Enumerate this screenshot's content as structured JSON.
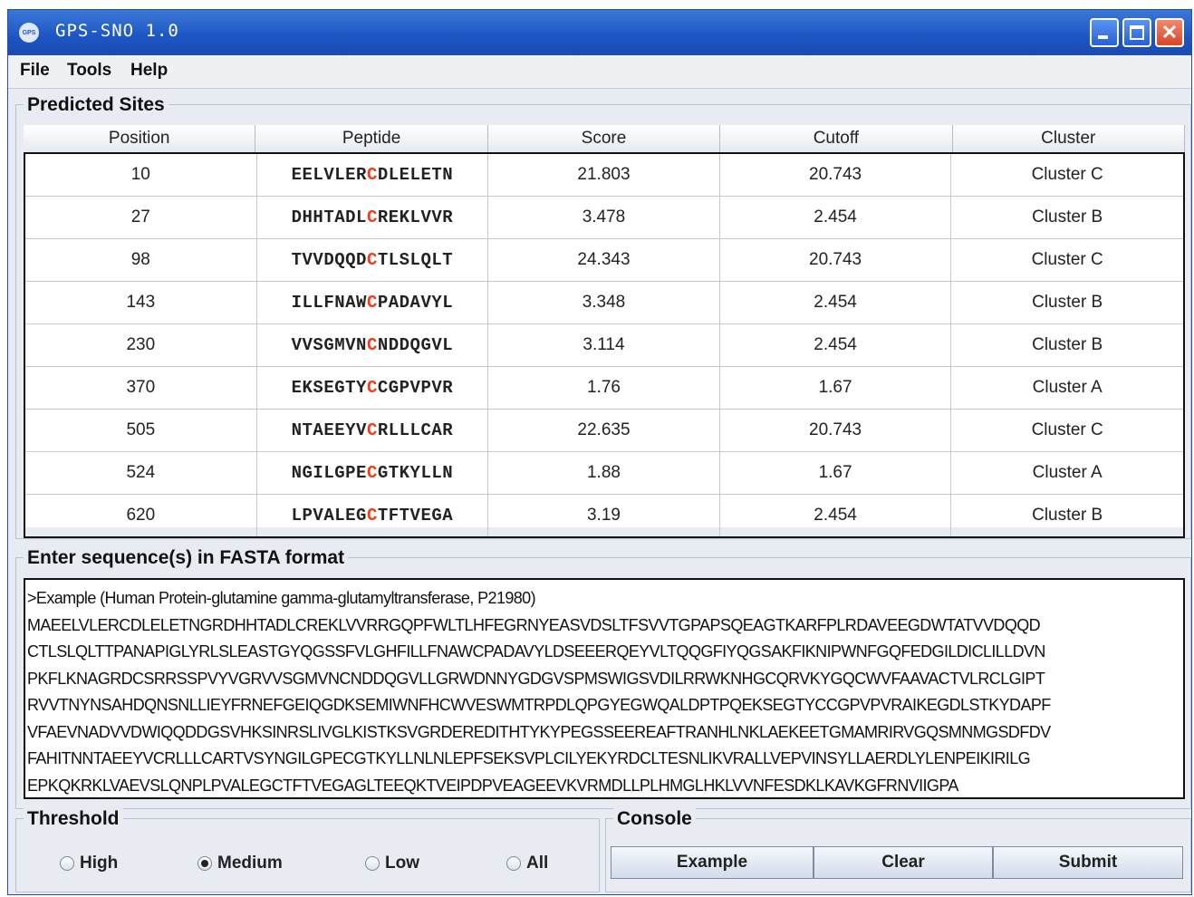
{
  "window": {
    "logo_text": "GPS",
    "title": "GPS-SNO 1.0",
    "minimize_label": "",
    "maximize_label": "",
    "close_label": "✕"
  },
  "menu": [
    "File",
    "Tools",
    "Help"
  ],
  "predicted_sites": {
    "title": "Predicted Sites",
    "columns": [
      "Position",
      "Peptide",
      "Score",
      "Cutoff",
      "Cluster"
    ],
    "rows": [
      {
        "position": "10",
        "pep_pre": "EELVLER",
        "pep_c": "C",
        "pep_post": "DLELETN",
        "score": "21.803",
        "cutoff": "20.743",
        "cluster": "Cluster C"
      },
      {
        "position": "27",
        "pep_pre": "DHHTADL",
        "pep_c": "C",
        "pep_post": "REKLVVR",
        "score": "3.478",
        "cutoff": "2.454",
        "cluster": "Cluster B"
      },
      {
        "position": "98",
        "pep_pre": "TVVDQQD",
        "pep_c": "C",
        "pep_post": "TLSLQLT",
        "score": "24.343",
        "cutoff": "20.743",
        "cluster": "Cluster C"
      },
      {
        "position": "143",
        "pep_pre": "ILLFNAW",
        "pep_c": "C",
        "pep_post": "PADAVYL",
        "score": "3.348",
        "cutoff": "2.454",
        "cluster": "Cluster B"
      },
      {
        "position": "230",
        "pep_pre": "VVSGMVN",
        "pep_c": "C",
        "pep_post": "NDDQGVL",
        "score": "3.114",
        "cutoff": "2.454",
        "cluster": "Cluster B"
      },
      {
        "position": "370",
        "pep_pre": "EKSEGTY",
        "pep_c": "C",
        "pep_post": "CGPVPVR",
        "score": "1.76",
        "cutoff": "1.67",
        "cluster": "Cluster A"
      },
      {
        "position": "505",
        "pep_pre": "NTAEEYV",
        "pep_c": "C",
        "pep_post": "RLLLCAR",
        "score": "22.635",
        "cutoff": "20.743",
        "cluster": "Cluster C"
      },
      {
        "position": "524",
        "pep_pre": "NGILGPE",
        "pep_c": "C",
        "pep_post": "GTKYLLN",
        "score": "1.88",
        "cutoff": "1.67",
        "cluster": "Cluster A"
      },
      {
        "position": "620",
        "pep_pre": "LPVALEG",
        "pep_c": "C",
        "pep_post": "TFTVEGA",
        "score": "3.19",
        "cutoff": "2.454",
        "cluster": "Cluster B"
      }
    ]
  },
  "fasta": {
    "title": "Enter sequence(s) in FASTA format",
    "lines": [
      ">Example (Human Protein-glutamine gamma-glutamyltransferase, P21980)",
      "MAEELVLERCDLELETNGRDHHTADLCREKLVVRRGQPFWLTLHFEGRNYEASVDSLTFSVVTGPAPSQEAGTKARFPLRDAVEEGDWTATVVDQQD",
      "CTLSLQLTTPANAPIGLYRLSLEASTGYQGSSFVLGHFILLFNAWCPADAVYLDSEEERQEYVLTQQGFIYQGSAKFIKNIPWNFGQFEDGILDICLILLDVN",
      "PKFLKNAGRDCSRRSSPVYVGRVVSGMVNCNDDQGVLLGRWDNNYGDGVSPMSWIGSVDILRRWKNHGCQRVKYGQCWVFAAVACTVLRCLGIPT",
      "RVVTNYNSAHDQNSNLLIEYFRNEFGEIQGDKSEMIWNFHCWVESWMTRPDLQPGYEGWQALDPTPQEKSEGTYCCGPVPVRAIKEGDLSTKYDAPF",
      "VFAEVNADVVDWIQQDDGSVHKSINRSLIVGLKISTKSVGRDEREDITHTYKYPEGSSEEREAFTRANHLNKLAEKEETGMAMRIRVGQSMNMGSDFDV",
      "FAHITNNTAEEYVCRLLLCARTVSYNGILGPECGTKYLLNLNLEPFSEKSVPLCILYEKYRDCLTESNLIKVRALLVEPVINSYLLAERDLYLENPEIKIRILG",
      "EPKQKRKLVAEVSLQNPLPVALEGCTFTVEGAGLTEEQKTVEIPDPVEAGEEVKVRMDLLPLHMGLHKLVVNFESDKLKAVKGFRNVIIGPA"
    ]
  },
  "threshold": {
    "title": "Threshold",
    "options": [
      "High",
      "Medium",
      "Low",
      "All"
    ],
    "selected": "Medium"
  },
  "console": {
    "title": "Console",
    "buttons": [
      "Example",
      "Clear",
      "Submit"
    ]
  },
  "colors": {
    "titlebar": "#1d55c4",
    "highlight": "#ee3d1a",
    "panel_bg": "#e8ecf2"
  }
}
